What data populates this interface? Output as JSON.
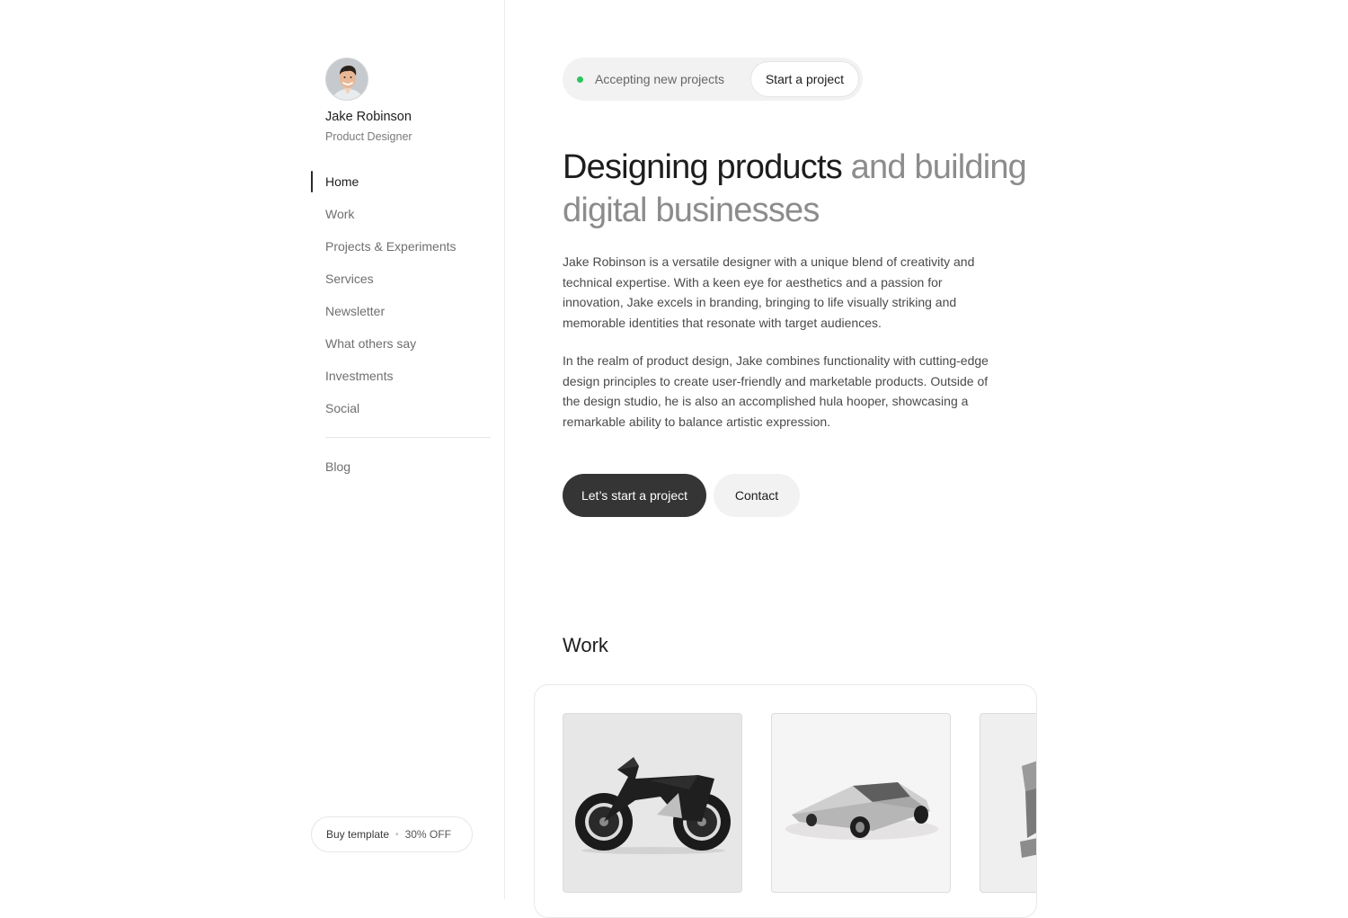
{
  "profile": {
    "name": "Jake Robinson",
    "role": "Product Designer"
  },
  "nav": {
    "items": [
      {
        "label": "Home",
        "active": true
      },
      {
        "label": "Work",
        "active": false
      },
      {
        "label": "Projects & Experiments",
        "active": false
      },
      {
        "label": "Services",
        "active": false
      },
      {
        "label": "Newsletter",
        "active": false
      },
      {
        "label": "What others say",
        "active": false
      },
      {
        "label": "Investments",
        "active": false
      },
      {
        "label": "Social",
        "active": false
      }
    ],
    "blog_label": "Blog"
  },
  "buy_template": {
    "label": "Buy template",
    "discount": "30% OFF"
  },
  "status": {
    "text": "Accepting new projects",
    "button_label": "Start a project",
    "indicator_color": "#2bc65b"
  },
  "hero": {
    "title_strong": "Designing products",
    "title_muted": " and building digital businesses",
    "paragraph_1": "Jake Robinson is a versatile designer with a unique blend of creativity and technical expertise. With a keen eye for aesthetics and a passion for innovation, Jake excels in branding, bringing to life visually striking and memorable identities that resonate with target audiences.",
    "paragraph_2": "In the realm of product design, Jake combines functionality with cutting-edge design principles to create user-friendly and marketable products. Outside of the design studio, he is also an accomplished hula hooper, showcasing a remarkable ability to balance artistic expression.",
    "primary_cta": "Let’s start a project",
    "secondary_cta": "Contact"
  },
  "work": {
    "title": "Work",
    "cards": [
      {
        "image": "motorcycle-render"
      },
      {
        "image": "wedge-car-render"
      },
      {
        "image": "metal-sculpture-render"
      }
    ]
  },
  "colors": {
    "primary_button": "#353535",
    "muted_text": "#8c8c8c",
    "pill_background": "#f2f2f2"
  }
}
